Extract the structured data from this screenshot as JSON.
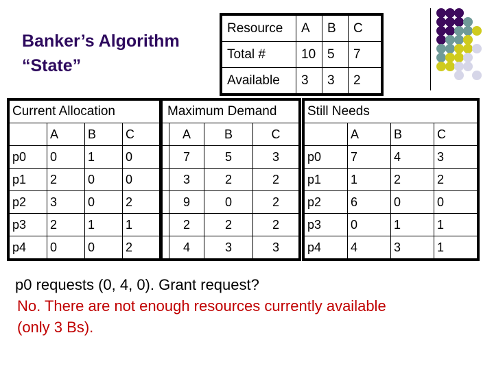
{
  "slide": {
    "title_line1": "Banker’s Algorithm",
    "title_line2": "“State”",
    "decoration": "dot-grid-icon",
    "dot_colors": {
      "purple": "#3d0a5c",
      "teal": "#6f9a98",
      "yellow": "#cfcb1e",
      "lavender": "#d6d6e8"
    }
  },
  "resource_table": {
    "header": [
      "Resource",
      "A",
      "B",
      "C"
    ],
    "rows": [
      [
        "Total #",
        "10",
        "5",
        "7"
      ],
      [
        "Available",
        "3",
        "3",
        "2"
      ]
    ]
  },
  "current_allocation": {
    "title": "Current Allocation",
    "columns": [
      "",
      "A",
      "B",
      "C"
    ],
    "rows": [
      [
        "p0",
        "0",
        "1",
        "0"
      ],
      [
        "p1",
        "2",
        "0",
        "0"
      ],
      [
        "p2",
        "3",
        "0",
        "2"
      ],
      [
        "p3",
        "2",
        "1",
        "1"
      ],
      [
        "p4",
        "0",
        "0",
        "2"
      ]
    ]
  },
  "maximum_demand": {
    "title": "Maximum Demand",
    "columns": [
      "A",
      "B",
      "C"
    ],
    "rows": [
      [
        "7",
        "5",
        "3"
      ],
      [
        "3",
        "2",
        "2"
      ],
      [
        "9",
        "0",
        "2"
      ],
      [
        "2",
        "2",
        "2"
      ],
      [
        "4",
        "3",
        "3"
      ]
    ]
  },
  "still_needs": {
    "title": "Still Needs",
    "columns": [
      "",
      "A",
      "B",
      "C"
    ],
    "rows": [
      [
        "p0",
        "7",
        "4",
        "3"
      ],
      [
        "p1",
        "1",
        "2",
        "2"
      ],
      [
        "p2",
        "6",
        "0",
        "0"
      ],
      [
        "p3",
        "0",
        "1",
        "1"
      ],
      [
        "p4",
        "4",
        "3",
        "1"
      ]
    ]
  },
  "question": "p0 requests (0, 4, 0).  Grant request?",
  "answer_line1": "No.  There are not enough resources currently available",
  "answer_line2": "(only 3 Bs)."
}
